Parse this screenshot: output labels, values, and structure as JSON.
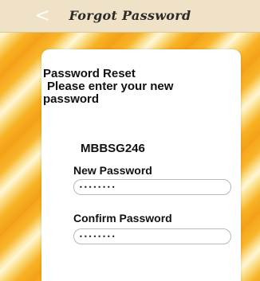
{
  "header": {
    "back_icon": "chevron-left-icon",
    "back_glyph": "<",
    "title": "Forgot Password"
  },
  "form": {
    "heading_line1": "Password Reset",
    "heading_line2": "Please enter your new",
    "heading_line3": "password",
    "username": "MBBSG246",
    "new_password": {
      "label": "New Password",
      "value": "••••••••"
    },
    "confirm_password": {
      "label": "Confirm Password",
      "value": "••••••••"
    }
  },
  "colors": {
    "header_bg": "#efe2c6",
    "background_primary": "#f6a51c",
    "background_highlight": "#fff6d6",
    "card_bg": "#ffffff"
  }
}
